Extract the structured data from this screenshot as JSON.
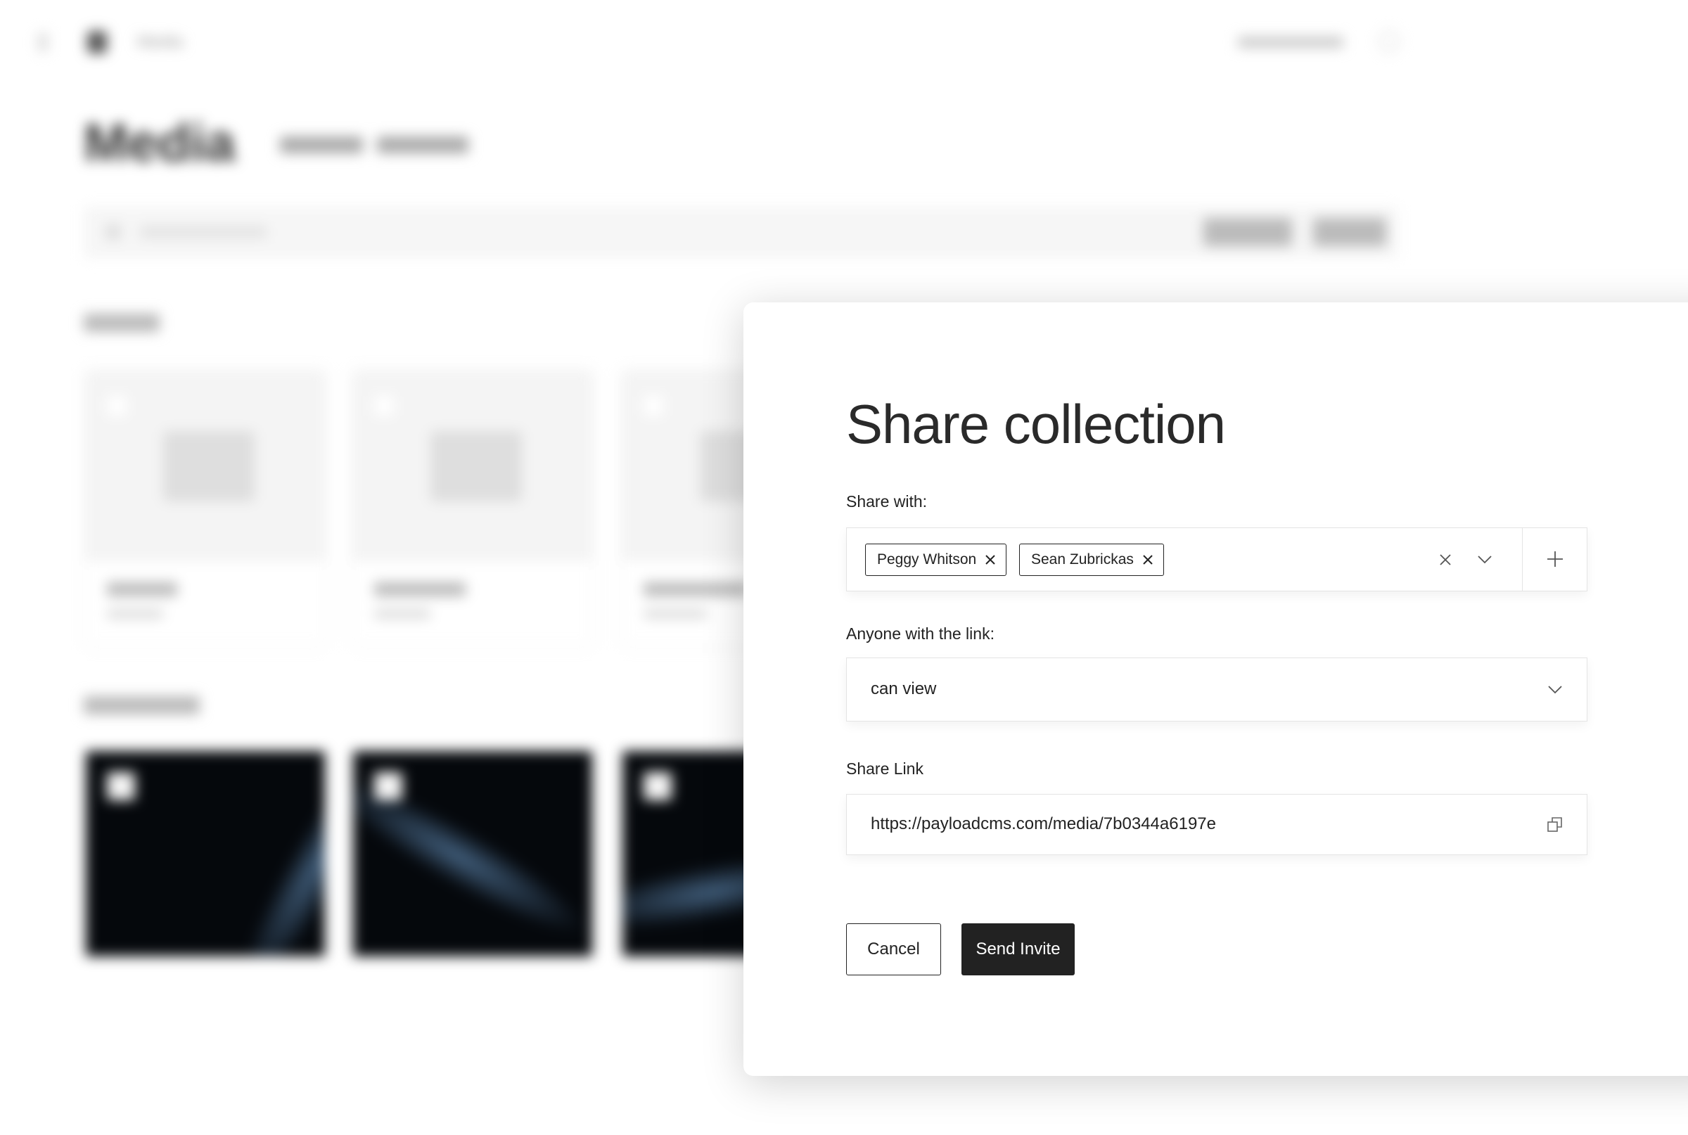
{
  "background": {
    "breadcrumb": "Media",
    "page_title": "Media"
  },
  "modal": {
    "title": "Share collection",
    "share_with_label": "Share with:",
    "recipients": [
      "Peggy Whitson",
      "Sean Zubrickas"
    ],
    "link_access_label": "Anyone with the link:",
    "link_access_value": "can view",
    "share_link_label": "Share Link",
    "share_link_value": "https://payloadcms.com/media/7b0344a6197e",
    "cancel_label": "Cancel",
    "send_label": "Send Invite",
    "icons": {
      "clear": "close-icon",
      "expand": "chevron-down-icon",
      "add": "plus-icon",
      "copy": "copy-icon"
    },
    "colors": {
      "primary_button": "#222222",
      "text": "#222222",
      "border": "#e4e4e4"
    }
  }
}
